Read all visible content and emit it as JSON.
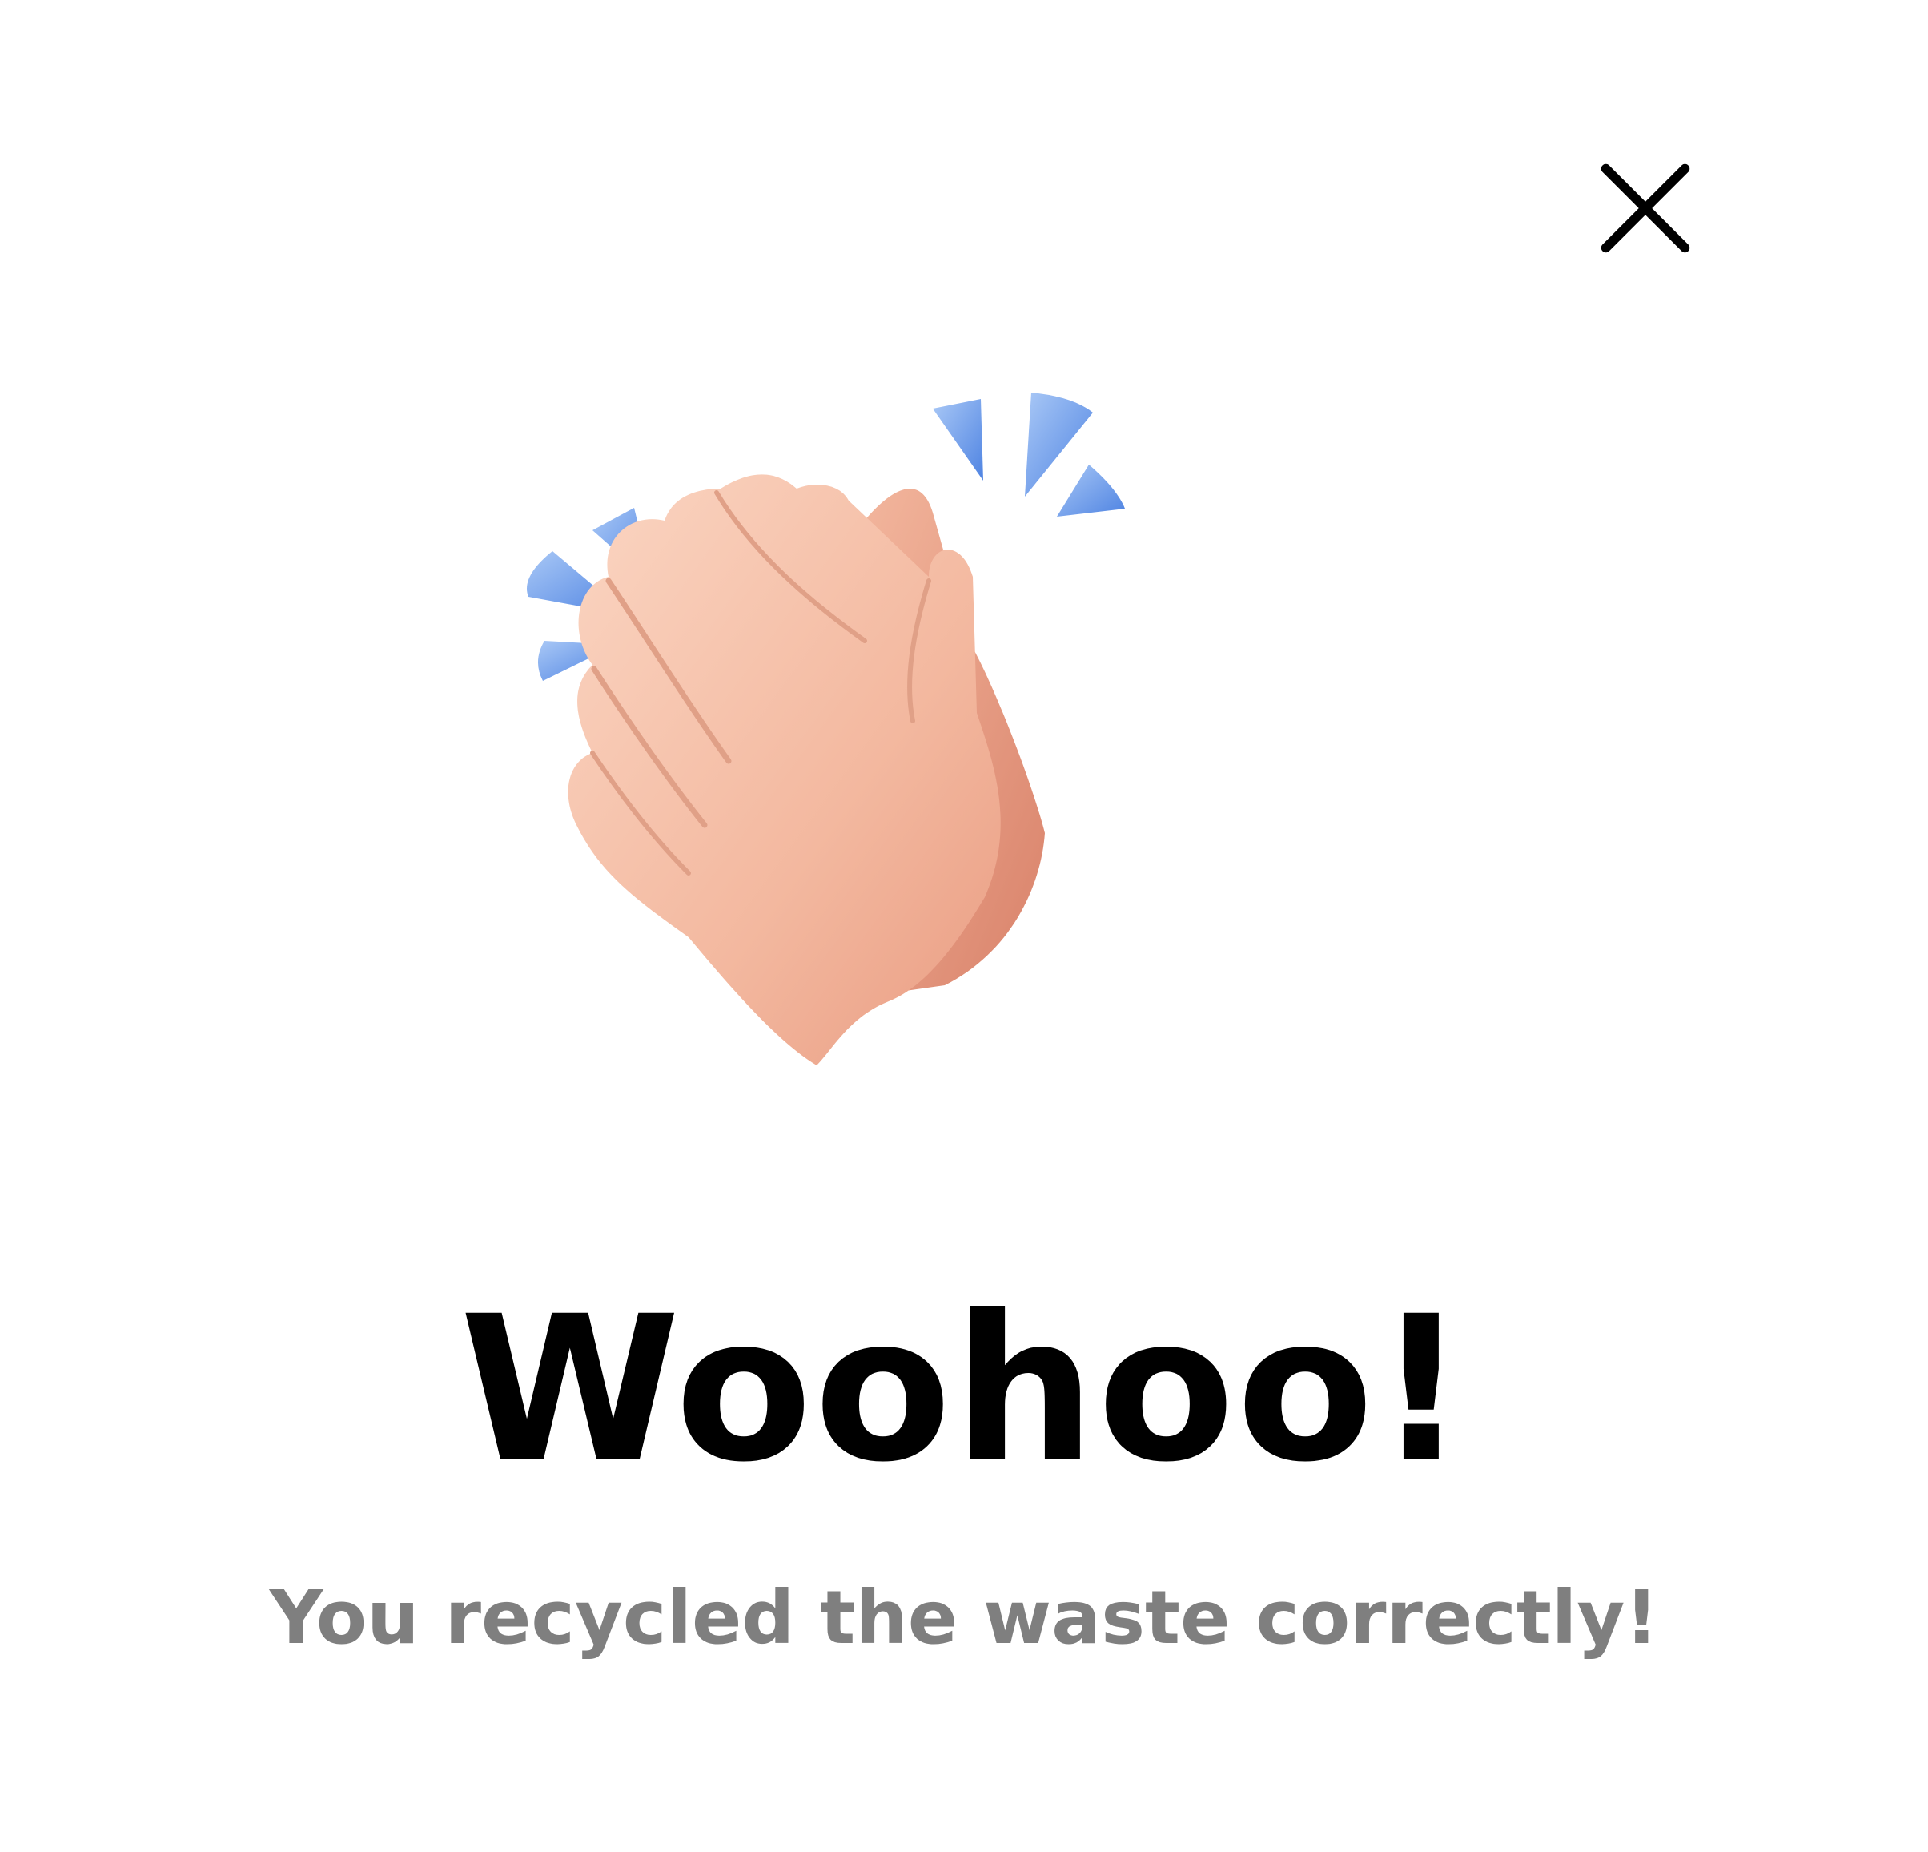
{
  "dialog": {
    "close_icon": "close-icon",
    "illustration_icon": "clapping-hands-icon",
    "title": "Woohoo!",
    "message": "You recycled the waste correctly!"
  },
  "colors": {
    "background": "#ffffff",
    "title": "#000000",
    "message": "#7f7f7f",
    "accent_sparks": "#6b9be8",
    "skin": "#f2b49a"
  }
}
